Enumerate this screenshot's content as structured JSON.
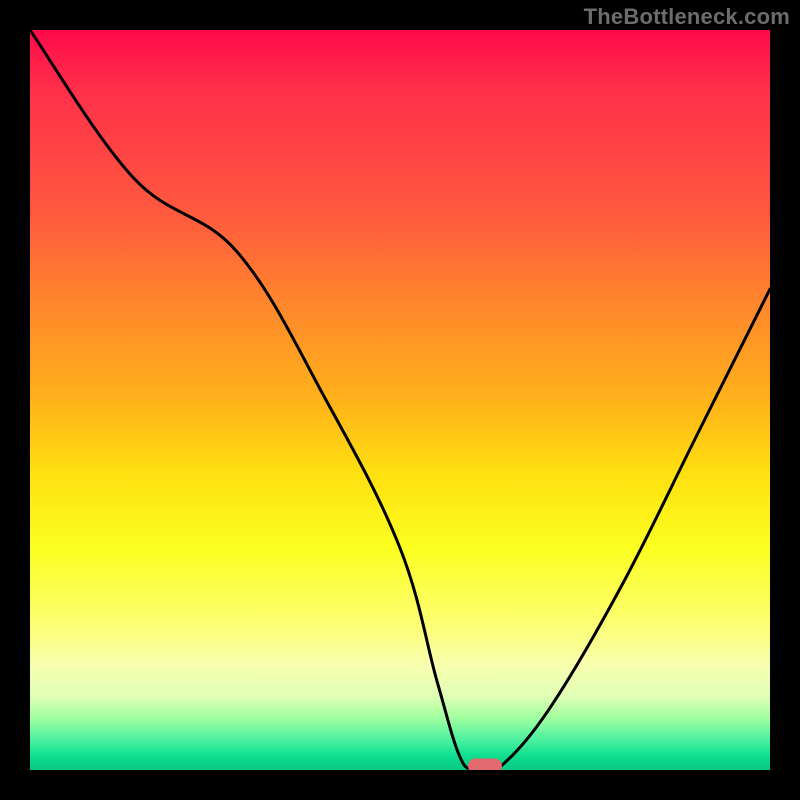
{
  "watermark_text": "TheBottleneck.com",
  "chart_data": {
    "type": "line",
    "title": "",
    "xlabel": "",
    "ylabel": "",
    "xlim": [
      0,
      100
    ],
    "ylim": [
      0,
      100
    ],
    "grid": false,
    "x": [
      0,
      14,
      28,
      40,
      50,
      55,
      58,
      60,
      63,
      70,
      80,
      90,
      100
    ],
    "values": [
      100,
      80,
      70,
      50,
      30,
      12,
      2,
      0,
      0,
      8,
      25,
      45,
      65
    ],
    "marker": {
      "x": 61.5,
      "y": 0
    },
    "background_gradient": {
      "orientation": "vertical",
      "stops": [
        {
          "pos": 0.0,
          "color": "#ff0a4a"
        },
        {
          "pos": 0.25,
          "color": "#ff5a3e"
        },
        {
          "pos": 0.5,
          "color": "#ffb21a"
        },
        {
          "pos": 0.7,
          "color": "#fbff20"
        },
        {
          "pos": 0.88,
          "color": "#f7ffb0"
        },
        {
          "pos": 0.96,
          "color": "#49f0a0"
        },
        {
          "pos": 1.0,
          "color": "#07c880"
        }
      ]
    }
  }
}
